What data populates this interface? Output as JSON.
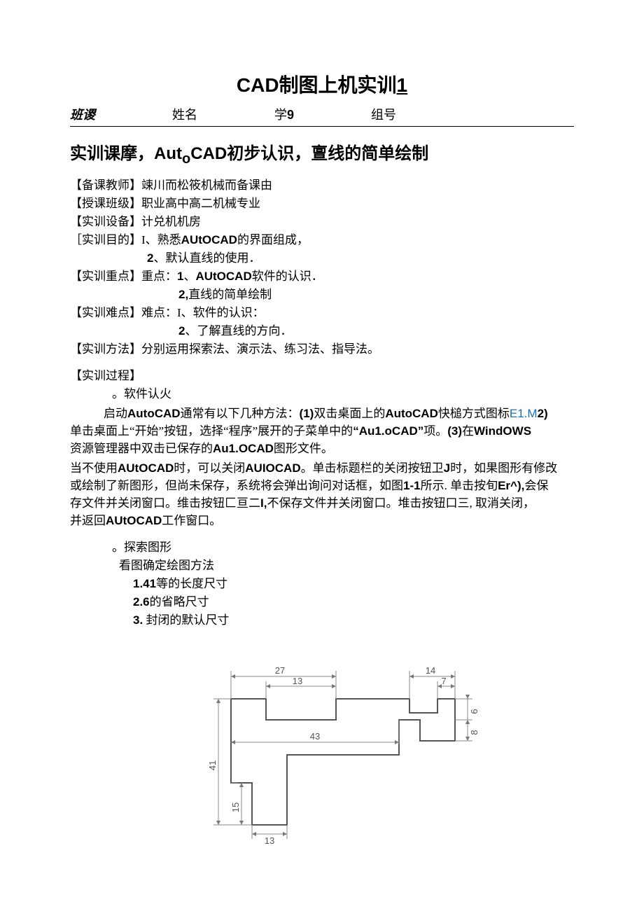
{
  "title": {
    "prefix": "CAD制图上机实训",
    "num": "1"
  },
  "form": {
    "ban": "班谡",
    "name": "姓名",
    "xue_label": "学",
    "xue_num": "9",
    "zu": "组号"
  },
  "subtitle": "实训课摩，AutoCAD初步认识，亶线的简单绘制",
  "meta": {
    "teacher_label": "【备课教师】",
    "teacher_val": "竦川而松筱机械而备课由",
    "class_label": "【授课班级】",
    "class_val": "职业高中高二机械专业",
    "equip_label": "【实训设备】",
    "equip_val": "计兑机机房",
    "goal_label": "［实训目的】",
    "goal_1_pre": "I、熟悉",
    "goal_1_bold": "AUtOCAD",
    "goal_1_post": "的界面组成，",
    "goal_2_pre": "2",
    "goal_2_post": "、默认直线的使用．",
    "focus_label": "【实训重点】",
    "focus_pre": "重点：",
    "focus_1_pre": "1",
    "focus_1_mid": "、",
    "focus_1_bold": "AUtOCAD",
    "focus_1_post": "软件的认识．",
    "focus_2_pre": "2,",
    "focus_2_post": "直线的简单绘制",
    "diff_label": "【实训难点】",
    "diff_pre": "难点：",
    "diff_1": "I、软件的认识：",
    "diff_2_pre": "2",
    "diff_2_post": "、了解直线的方向．",
    "method_label": "【实训方法】",
    "method_val": "分别运用探索法、演示法、练习法、指导法。",
    "proc_label": "【实训过程】",
    "proc_b1": "。软件认火",
    "proc_b2": "。探索图形",
    "look": "看图确定绘图方法",
    "item1_num": "1.41",
    "item1_txt": "等的长度尺寸",
    "item2_num": "2.6",
    "item2_txt": "的省略尺寸",
    "item3_num": "3.",
    "item3_txt": " 封闭的默认尺寸"
  },
  "para1": {
    "indent_pre": "启动",
    "b1": "AutoCAD",
    "t1": "通常有以下几种方法：",
    "b2": "(1)",
    "t2": "双击桌面上的",
    "b3": "AutoCAD",
    "t3": "快槌方式图标",
    "link1": "E1.M",
    "b4": "2)",
    "line2a": "单击桌面上“开始”按钮，选择“程序”展开的子菜单中的",
    "b5": "“Au1.oCAD”",
    "t5": "项。",
    "b6": "(3)",
    "t6": "在",
    "b7": "WindOWS",
    "line3a": "资源管理器中双击已保存的",
    "b8": "Au1.OCAD",
    "t8": "图形文件。"
  },
  "para2": {
    "t1": "当不使用",
    "b1": "AUtOCAD",
    "t2": "时，可以关闭",
    "b2": "AUIOCAD",
    "t3": "。单击标题栏的关闭按钮卫",
    "b3": "J",
    "t4": "时，如果图形有修改",
    "line2": "或绘制了新图形，但尚未保存，系统将会弹出询问对话框，如图",
    "b4": "1-1",
    "t5": "所示. 单击按旬",
    "b5": "Er^),",
    "t6": "会保",
    "line3": "存文件并关闭窗口。维击按钮匚亘二",
    "b6": "I,",
    "t7": "不保存文件并关闭窗口。堆击按钮口三, 取消关闭，",
    "line4a": "并返回",
    "b7": "AUtOCAD",
    "t8": "工作窗口。"
  },
  "dims": {
    "d27": "27",
    "d13a": "13",
    "d14": "14",
    "d7": "7",
    "d43": "43",
    "d41": "41",
    "d15": "15",
    "d13b": "13",
    "d6": "6",
    "d8": "8"
  }
}
